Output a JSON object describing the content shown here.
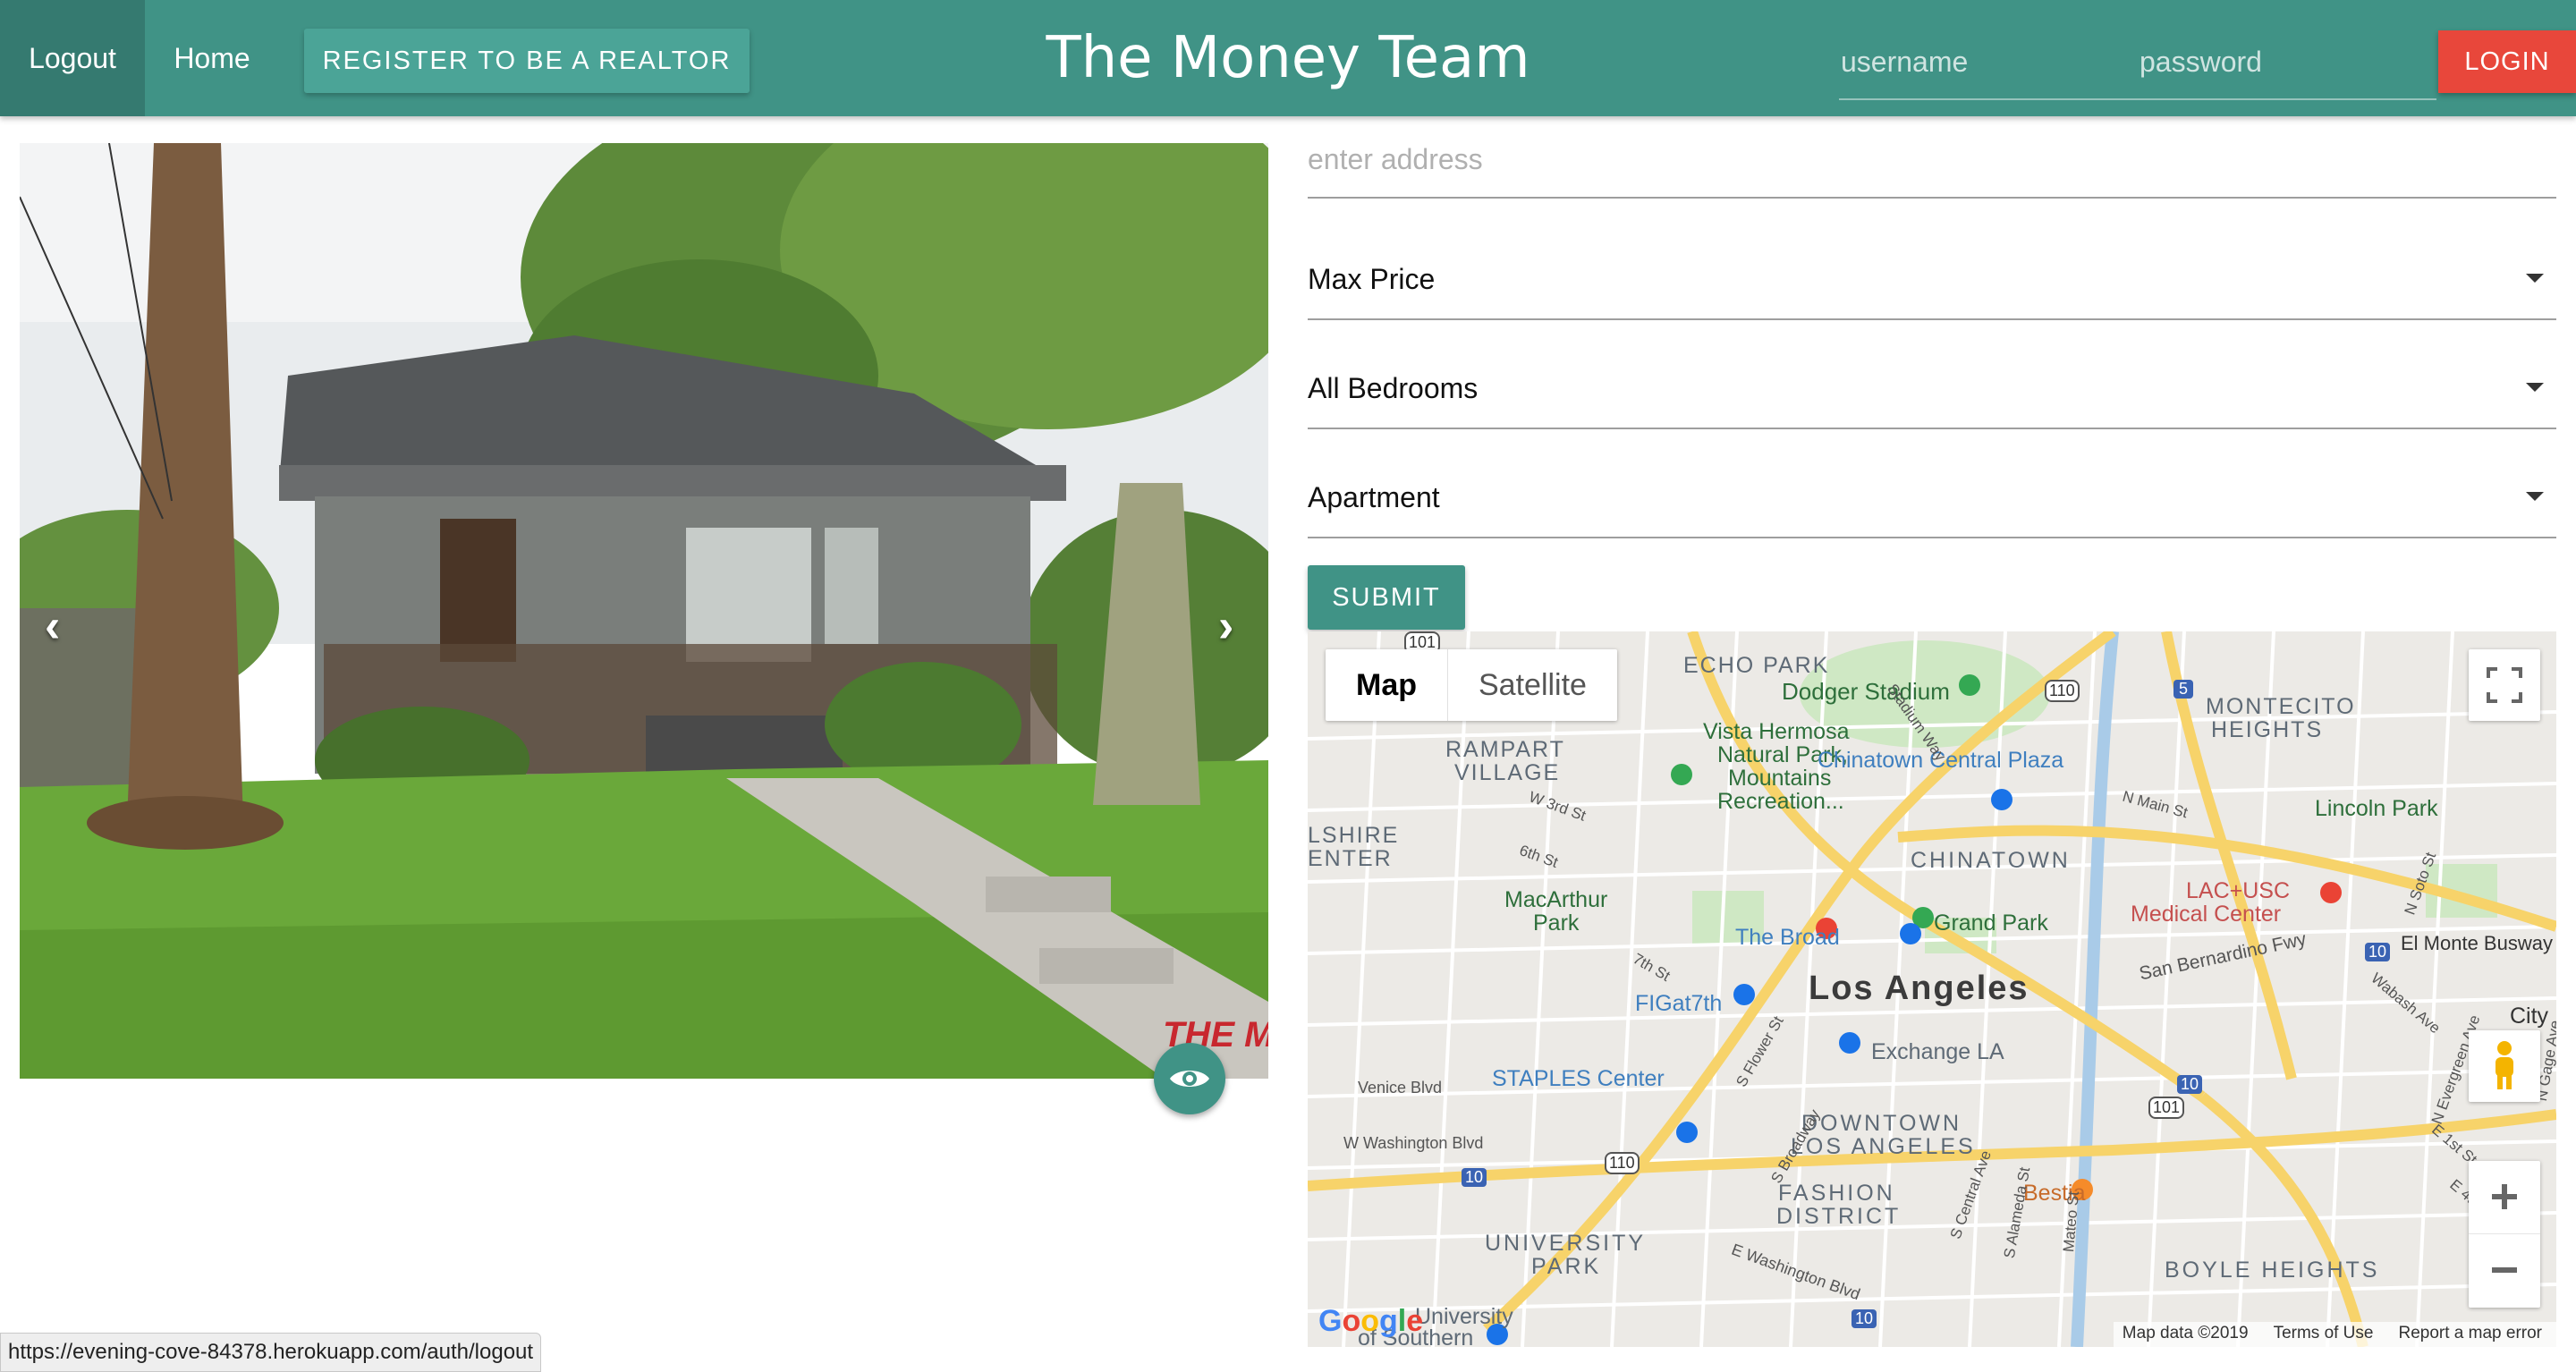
{
  "navbar": {
    "logout_label": "Logout",
    "home_label": "Home",
    "register_label": "REGISTER TO BE A REALTOR",
    "title": "The Money Team",
    "username_placeholder": "username",
    "password_placeholder": "password",
    "login_label": "LOGIN",
    "brand_color": "#409386",
    "login_color": "#e8473b"
  },
  "carousel": {
    "prev_icon": "chevron-left-icon",
    "next_icon": "chevron-right-icon",
    "prev_glyph": "‹",
    "next_glyph": "›",
    "view_icon": "eye-icon",
    "watermark": "THE MLS .COM"
  },
  "search": {
    "address_placeholder": "enter address",
    "max_price": "Max Price",
    "bedrooms": "All Bedrooms",
    "property_type": "Apartment",
    "submit_label": "SUBMIT"
  },
  "map": {
    "type_map": "Map",
    "type_satellite": "Satellite",
    "labels": {
      "echo_park": "ECHO PARK",
      "dodger_stadium": "Dodger Stadium",
      "montecito_1": "MONTECITO",
      "montecito_2": "HEIGHTS",
      "rampart_1": "RAMPART",
      "rampart_2": "VILLAGE",
      "vista_1": "Vista Hermosa",
      "vista_2": "Natural Park,",
      "vista_3": "Mountains",
      "vista_4": "Recreation...",
      "chinatown_plaza": "Chinatown Central Plaza",
      "lincoln_park": "Lincoln Park",
      "wilshire_1": "LSHIRE",
      "wilshire_2": "ENTER",
      "chinatown": "CHINATOWN",
      "lac_1": "LAC+USC",
      "lac_2": "Medical Center",
      "macarthur_1": "MacArthur",
      "macarthur_2": "Park",
      "the_broad": "The Broad",
      "grand_park": "Grand Park",
      "el_monte": "El Monte Busway",
      "sb_fwy": "San Bernardino Fwy",
      "figat7th": "FIGat7th",
      "los_angeles": "Los Angeles",
      "city": "City",
      "exchange": "Exchange LA",
      "venice": "Venice Blvd",
      "staples": "STAPLES Center",
      "downtown_1": "DOWNTOWN",
      "downtown_2": "LOS ANGELES",
      "w_washington": "W Washington Blvd",
      "fashion_1": "FASHION",
      "fashion_2": "DISTRICT",
      "bestia": "Bestia",
      "university_1": "UNIVERSITY",
      "university_2": "PARK",
      "boyle": "BOYLE HEIGHTS",
      "e_washington": "E Washington Blvd",
      "stadium_way": "Stadium Way",
      "w_3rd": "W 3rd St",
      "sixth": "6th St",
      "seventh": "7th St",
      "n_main": "N Main St",
      "s_flower": "S Flower St",
      "s_broadway": "S Broadway",
      "s_central": "S Central Ave",
      "s_alameda": "S Alameda St",
      "mateo": "Mateo St",
      "wabash": "Wabash Ave",
      "evergreen": "N Evergreen Ave",
      "e_1st": "E 1st St",
      "e_4th": "E 4th St",
      "gage": "N Gage Ave",
      "soto": "N Soto St",
      "university_bottom": "University",
      "of_southern": "of Southern",
      "hwy_110a": "110",
      "hwy_110b": "110",
      "hwy_5": "5",
      "hwy_10a": "10",
      "hwy_10b": "10",
      "hwy_10c": "10",
      "hwy_10d": "10",
      "hwy_101a": "101",
      "hwy_101b": "101"
    },
    "google_logo": "Google",
    "footer": {
      "map_data": "Map data ©2019",
      "terms": "Terms of Use",
      "report": "Report a map error"
    }
  },
  "status_bar": {
    "url": "https://evening-cove-84378.herokuapp.com/auth/logout"
  }
}
